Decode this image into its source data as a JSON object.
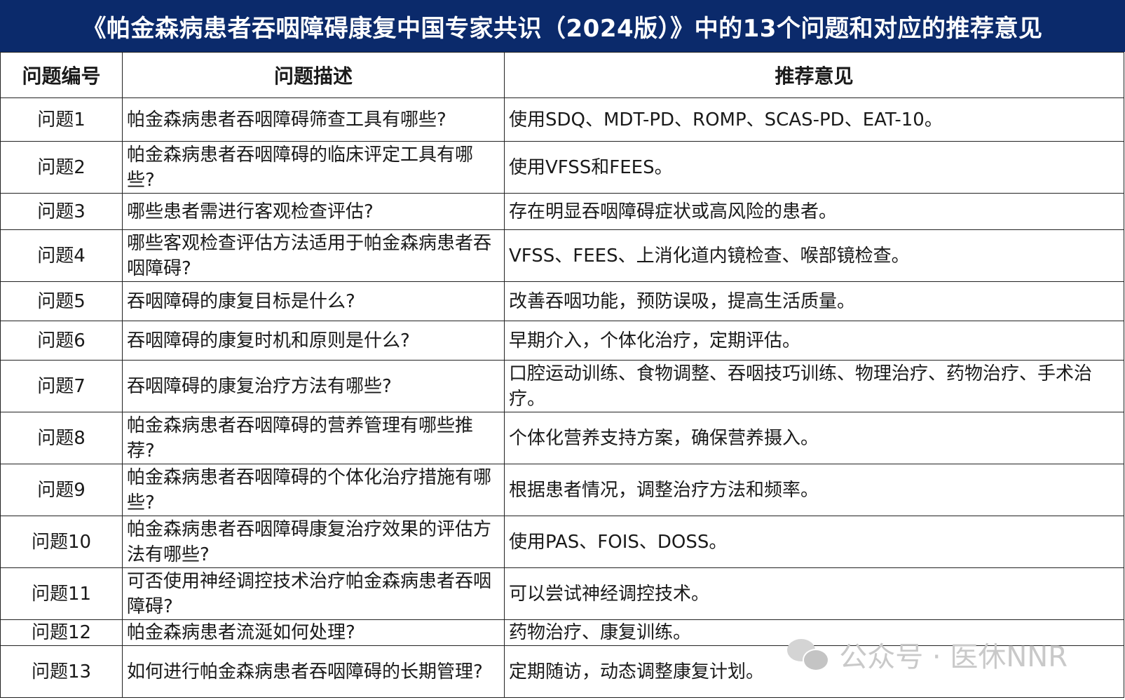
{
  "title": "《帕金森病患者吞咽障碍康复中国专家共识（2024版）》中的13个问题和对应的推荐意见",
  "headers": {
    "num": "问题编号",
    "question": "问题描述",
    "recommendation": "推荐意见"
  },
  "rows": [
    {
      "num": "问题1",
      "question": "帕金森病患者吞咽障碍筛查工具有哪些?",
      "recommendation": "使用SDQ、MDT-PD、ROMP、SCAS-PD、EAT-10。"
    },
    {
      "num": "问题2",
      "question": "帕金森病患者吞咽障碍的临床评定工具有哪些?",
      "recommendation": "使用VFSS和FEES。"
    },
    {
      "num": "问题3",
      "question": "哪些患者需进行客观检查评估?",
      "recommendation": "存在明显吞咽障碍症状或高风险的患者。"
    },
    {
      "num": "问题4",
      "question": "哪些客观检查评估方法适用于帕金森病患者吞咽障碍?",
      "recommendation": "VFSS、FEES、上消化道内镜检查、喉部镜检查。"
    },
    {
      "num": "问题5",
      "question": "吞咽障碍的康复目标是什么?",
      "recommendation": "改善吞咽功能，预防误吸，提高生活质量。"
    },
    {
      "num": "问题6",
      "question": "吞咽障碍的康复时机和原则是什么?",
      "recommendation": "早期介入，个体化治疗，定期评估。"
    },
    {
      "num": "问题7",
      "question": "吞咽障碍的康复治疗方法有哪些?",
      "recommendation": "口腔运动训练、食物调整、吞咽技巧训练、物理治疗、药物治疗、手术治疗。"
    },
    {
      "num": "问题8",
      "question": "帕金森病患者吞咽障碍的营养管理有哪些推荐?",
      "recommendation": "个体化营养支持方案，确保营养摄入。"
    },
    {
      "num": "问题9",
      "question": "帕金森病患者吞咽障碍的个体化治疗措施有哪些?",
      "recommendation": "根据患者情况，调整治疗方法和频率。"
    },
    {
      "num": "问题10",
      "question": "帕金森病患者吞咽障碍康复治疗效果的评估方法有哪些?",
      "recommendation": "使用PAS、FOIS、DOSS。"
    },
    {
      "num": "问题11",
      "question": "可否使用神经调控技术治疗帕金森病患者吞咽障碍?",
      "recommendation": "可以尝试神经调控技术。"
    },
    {
      "num": "问题12",
      "question": "帕金森病患者流涎如何处理?",
      "recommendation": "药物治疗、康复训练。"
    },
    {
      "num": "问题13",
      "question": "如何进行帕金森病患者吞咽障碍的长期管理?",
      "recommendation": "定期随访，动态调整康复计划。"
    }
  ],
  "watermark": {
    "text": "公众号 · 医休NNR",
    "icon": "wechat-icon"
  },
  "colors": {
    "title_bg": "#0b2a6b",
    "title_text": "#ffffff",
    "border": "#222222"
  }
}
